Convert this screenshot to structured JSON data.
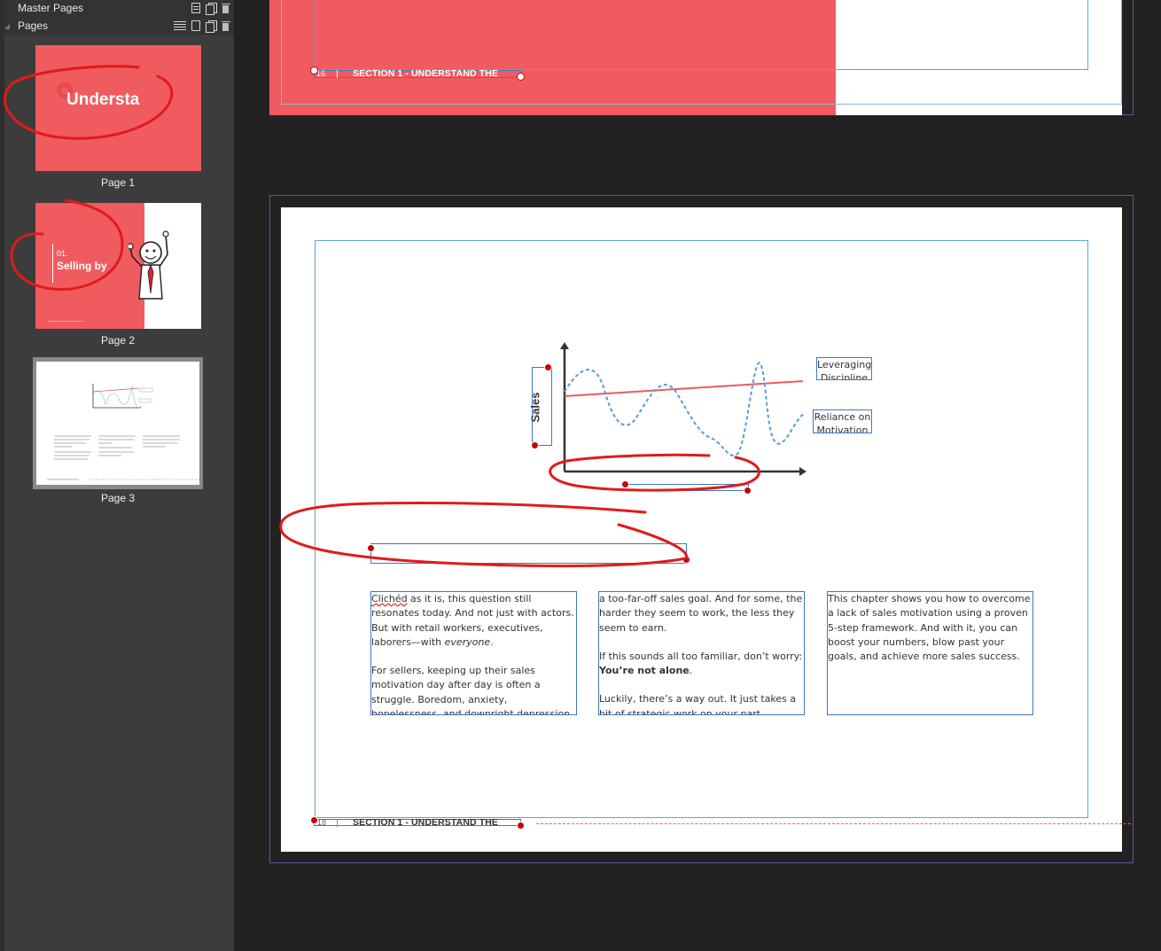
{
  "panel": {
    "master_pages_label": "Master Pages",
    "pages_label": "Pages",
    "thumbnails": [
      {
        "caption": "Page 1",
        "title": "Understa"
      },
      {
        "caption": "Page 2",
        "num": "01.",
        "title": "Selling by"
      },
      {
        "caption": "Page 3"
      }
    ]
  },
  "canvas": {
    "top_page": {
      "footer_number": "16",
      "footer_section": "SECTION 1 - UNDERSTAND THE"
    },
    "main_page": {
      "footer_number": "18",
      "footer_section": "SECTION 1 - UNDERSTAND THE",
      "chart": {
        "ylabel": "Sales",
        "label_discipline": "Leveraging Discipline",
        "label_motivation": "Reliance on Motivation"
      },
      "columns": {
        "col1_p1_word": "Clichéd",
        "col1_p1_rest": " as it is, this question still resonates today. And not just with actors. But with retail workers, executives, laborers—with ",
        "col1_p1_em": "everyone",
        "col1_p1_end": ".",
        "col1_p2": "For sellers, keeping up their sales motivation day after day is often a struggle. Boredom, anxiety, hopelessness, and downright depression can all be common in the face of",
        "col2_p1": "a too-far-off sales goal. And for some, the harder they seem to work, the less they seem to earn.",
        "col2_p2": "If this sounds all too familiar, don’t worry:",
        "col2_p2_bold": "You’re not alone",
        "col2_p2_end": ".",
        "col2_p3": "Luckily, there’s a way out. It just takes a bit of strategic work on your part.",
        "col3_p1": "This chapter shows you how to overcome a lack of sales motivation using a proven 5-step framework. And with it, you can boost your numbers, blow past your goals, and achieve more sales success."
      }
    }
  },
  "colors": {
    "accent": "#f05b5f",
    "annotation": "#e01b1b",
    "frame": "#3c78c8",
    "guide": "#5ba3d6",
    "spread": "#5f58a0"
  }
}
